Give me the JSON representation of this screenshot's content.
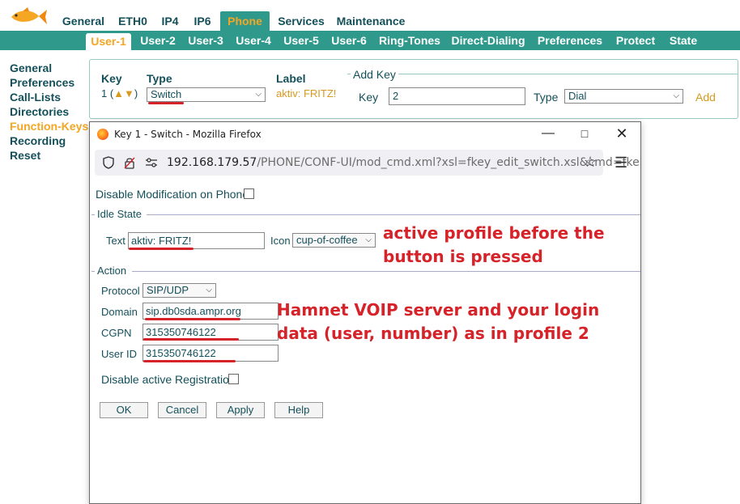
{
  "nav_main": [
    "General",
    "ETH0",
    "IP4",
    "IP6",
    "Phone",
    "Services",
    "Maintenance"
  ],
  "nav_sub": [
    "User-1",
    "User-2",
    "User-3",
    "User-4",
    "User-5",
    "User-6",
    "Ring-Tones",
    "Direct-Dialing",
    "Preferences",
    "Protect",
    "State"
  ],
  "side_menu": [
    "General",
    "Preferences",
    "Call-Lists",
    "Directories",
    "Function-Keys",
    "Recording",
    "Reset"
  ],
  "keybox": {
    "key_header": "Key",
    "type_header": "Type",
    "label_header": "Label",
    "key_value": "1 (",
    "key_arrows": "▲▼",
    "key_close": ")",
    "type_value": "Switch",
    "label_value": "aktiv: FRITZ!",
    "addkey_legend": "Add Key",
    "addkey_key_label": "Key",
    "addkey_key_value": "2",
    "addkey_type_label": "Type",
    "addkey_type_value": "Dial",
    "add_link": "Add"
  },
  "popup": {
    "title": "Key 1 - Switch - Mozilla Firefox",
    "url_host": "192.168.179.57",
    "url_path": "/PHONE/CONF-UI/mod_cmd.xml?xsl=fkey_edit_switch.xsl&cmd=fke",
    "disable_mod_label": "Disable Modification on Phone",
    "idle_state_legend": "Idle State",
    "text_label": "Text",
    "text_value": "aktiv: FRITZ!",
    "icon_label": "Icon",
    "icon_value": "cup-of-coffee",
    "action_legend": "Action",
    "protocol_label": "Protocol",
    "protocol_value": "SIP/UDP",
    "domain_label": "Domain",
    "domain_value": "sip.db0sda.ampr.org",
    "cgpn_label": "CGPN",
    "cgpn_value": "315350746122",
    "userid_label": "User ID",
    "userid_value": "315350746122",
    "disable_reg_label": "Disable active Registration",
    "buttons": {
      "ok": "OK",
      "cancel": "Cancel",
      "apply": "Apply",
      "help": "Help"
    }
  },
  "annotations": {
    "note1_line1": "active profile before the",
    "note1_line2": "button is pressed",
    "note2_line1": "Hamnet VOIP server and your login",
    "note2_line2": "data (user, number) as in profile 2"
  },
  "colors": {
    "teal": "#2f9a8c",
    "orange": "#f5a623",
    "text": "#14505a",
    "annotation_red": "#d6232a"
  },
  "icons": [
    "goldfish-logo",
    "firefox-logo",
    "minimize-icon",
    "maximize-icon",
    "close-icon",
    "shield-icon",
    "lock-icon",
    "permissions-icon",
    "star-icon",
    "hamburger-menu-icon",
    "chevron-down-icon"
  ]
}
